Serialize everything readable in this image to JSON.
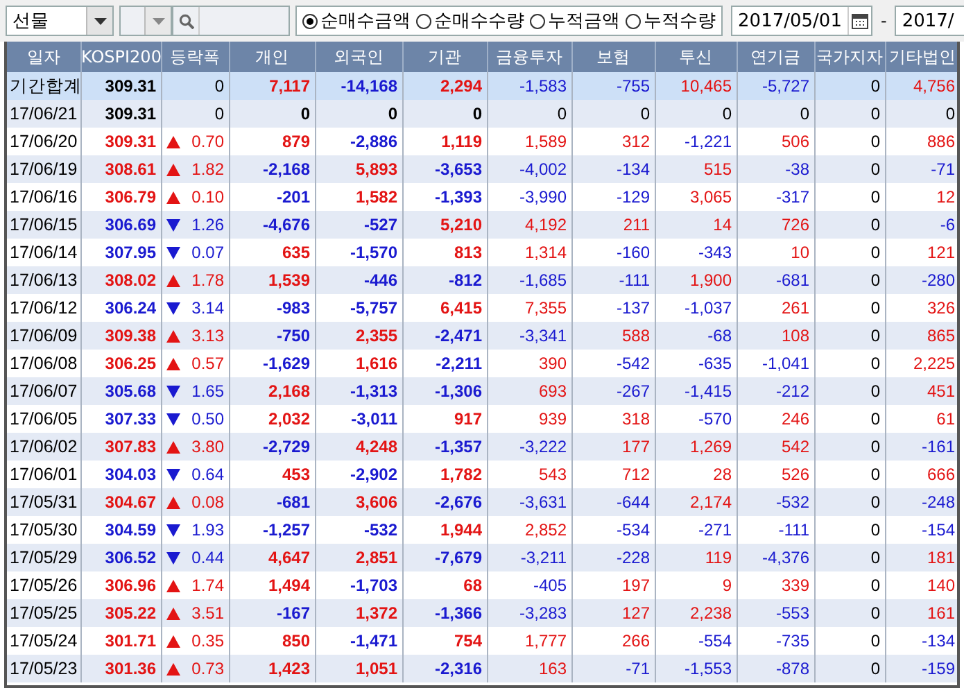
{
  "toolbar": {
    "market": "선물",
    "options": [
      {
        "label": "순매수금액",
        "selected": true
      },
      {
        "label": "순매수수량",
        "selected": false
      },
      {
        "label": "누적금액",
        "selected": false
      },
      {
        "label": "누적수량",
        "selected": false
      }
    ],
    "start_date": "2017/05/01",
    "separator": "-",
    "end_date": "2017/"
  },
  "table": {
    "columns": [
      "일자",
      "KOSPI200",
      "등락폭",
      "개인",
      "외국인",
      "기관",
      "금융투자",
      "보험",
      "투신",
      "연기금",
      "국가지자",
      "기타법인"
    ],
    "summary": {
      "label": "기간합계",
      "kospi": "309.31",
      "change": "0",
      "values": [
        "7,117",
        "-14,168",
        "2,294",
        "-1,583",
        "-755",
        "10,465",
        "-5,727",
        "0",
        "4,756"
      ]
    },
    "rows": [
      {
        "date": "17/06/21",
        "kospi": "309.31",
        "kind": "flat",
        "change": "0",
        "values": [
          "0",
          "0",
          "0",
          "0",
          "0",
          "0",
          "0",
          "0",
          "0"
        ]
      },
      {
        "date": "17/06/20",
        "kospi": "309.31",
        "kind": "up",
        "change": "0.70",
        "values": [
          "879",
          "-2,886",
          "1,119",
          "1,589",
          "312",
          "-1,221",
          "506",
          "0",
          "886"
        ]
      },
      {
        "date": "17/06/19",
        "kospi": "308.61",
        "kind": "up",
        "change": "1.82",
        "values": [
          "-2,168",
          "5,893",
          "-3,653",
          "-4,002",
          "-134",
          "515",
          "-38",
          "0",
          "-71"
        ]
      },
      {
        "date": "17/06/16",
        "kospi": "306.79",
        "kind": "up",
        "change": "0.10",
        "values": [
          "-201",
          "1,582",
          "-1,393",
          "-3,990",
          "-129",
          "3,065",
          "-317",
          "0",
          "12"
        ]
      },
      {
        "date": "17/06/15",
        "kospi": "306.69",
        "kind": "down",
        "change": "1.26",
        "values": [
          "-4,676",
          "-527",
          "5,210",
          "4,192",
          "211",
          "14",
          "726",
          "0",
          "-6"
        ]
      },
      {
        "date": "17/06/14",
        "kospi": "307.95",
        "kind": "down",
        "change": "0.07",
        "values": [
          "635",
          "-1,570",
          "813",
          "1,314",
          "-160",
          "-343",
          "10",
          "0",
          "121"
        ]
      },
      {
        "date": "17/06/13",
        "kospi": "308.02",
        "kind": "up",
        "change": "1.78",
        "values": [
          "1,539",
          "-446",
          "-812",
          "-1,685",
          "-111",
          "1,900",
          "-681",
          "0",
          "-280"
        ]
      },
      {
        "date": "17/06/12",
        "kospi": "306.24",
        "kind": "down",
        "change": "3.14",
        "values": [
          "-983",
          "-5,757",
          "6,415",
          "7,355",
          "-137",
          "-1,037",
          "261",
          "0",
          "326"
        ]
      },
      {
        "date": "17/06/09",
        "kospi": "309.38",
        "kind": "up",
        "change": "3.13",
        "values": [
          "-750",
          "2,355",
          "-2,471",
          "-3,341",
          "588",
          "-68",
          "108",
          "0",
          "865"
        ]
      },
      {
        "date": "17/06/08",
        "kospi": "306.25",
        "kind": "up",
        "change": "0.57",
        "values": [
          "-1,629",
          "1,616",
          "-2,211",
          "390",
          "-542",
          "-635",
          "-1,041",
          "0",
          "2,225"
        ]
      },
      {
        "date": "17/06/07",
        "kospi": "305.68",
        "kind": "down",
        "change": "1.65",
        "values": [
          "2,168",
          "-1,313",
          "-1,306",
          "693",
          "-267",
          "-1,415",
          "-212",
          "0",
          "451"
        ]
      },
      {
        "date": "17/06/05",
        "kospi": "307.33",
        "kind": "down",
        "change": "0.50",
        "values": [
          "2,032",
          "-3,011",
          "917",
          "939",
          "318",
          "-570",
          "246",
          "0",
          "61"
        ]
      },
      {
        "date": "17/06/02",
        "kospi": "307.83",
        "kind": "up",
        "change": "3.80",
        "values": [
          "-2,729",
          "4,248",
          "-1,357",
          "-3,222",
          "177",
          "1,269",
          "542",
          "0",
          "-161"
        ]
      },
      {
        "date": "17/06/01",
        "kospi": "304.03",
        "kind": "down",
        "change": "0.64",
        "values": [
          "453",
          "-2,902",
          "1,782",
          "543",
          "712",
          "28",
          "526",
          "0",
          "666"
        ]
      },
      {
        "date": "17/05/31",
        "kospi": "304.67",
        "kind": "up",
        "change": "0.08",
        "values": [
          "-681",
          "3,606",
          "-2,676",
          "-3,631",
          "-644",
          "2,174",
          "-532",
          "0",
          "-248"
        ]
      },
      {
        "date": "17/05/30",
        "kospi": "304.59",
        "kind": "down",
        "change": "1.93",
        "values": [
          "-1,257",
          "-532",
          "1,944",
          "2,852",
          "-534",
          "-271",
          "-111",
          "0",
          "-154"
        ]
      },
      {
        "date": "17/05/29",
        "kospi": "306.52",
        "kind": "down",
        "change": "0.44",
        "values": [
          "4,647",
          "2,851",
          "-7,679",
          "-3,211",
          "-228",
          "119",
          "-4,376",
          "0",
          "181"
        ]
      },
      {
        "date": "17/05/26",
        "kospi": "306.96",
        "kind": "up",
        "change": "1.74",
        "values": [
          "1,494",
          "-1,703",
          "68",
          "-405",
          "197",
          "9",
          "339",
          "0",
          "140"
        ]
      },
      {
        "date": "17/05/25",
        "kospi": "305.22",
        "kind": "up",
        "change": "3.51",
        "values": [
          "-167",
          "1,372",
          "-1,366",
          "-3,283",
          "127",
          "2,238",
          "-553",
          "0",
          "161"
        ]
      },
      {
        "date": "17/05/24",
        "kospi": "301.71",
        "kind": "up",
        "change": "0.35",
        "values": [
          "850",
          "-1,471",
          "754",
          "1,777",
          "266",
          "-554",
          "-735",
          "0",
          "-134"
        ]
      },
      {
        "date": "17/05/23",
        "kospi": "301.36",
        "kind": "up",
        "change": "0.73",
        "values": [
          "1,423",
          "1,051",
          "-2,316",
          "163",
          "-71",
          "-1,553",
          "-878",
          "0",
          "-159"
        ]
      }
    ]
  }
}
